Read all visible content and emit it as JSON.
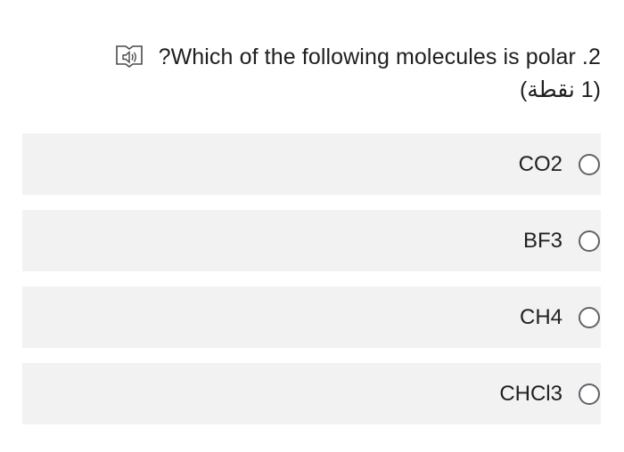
{
  "question": {
    "text": "?Which of the following molecules is polar .2",
    "points": "(1 نقطة)"
  },
  "icons": {
    "reader": "immersive-reader-icon"
  },
  "options": [
    {
      "label": "CO2"
    },
    {
      "label": "BF3"
    },
    {
      "label": "CH4"
    },
    {
      "label": "CHCl3"
    }
  ]
}
